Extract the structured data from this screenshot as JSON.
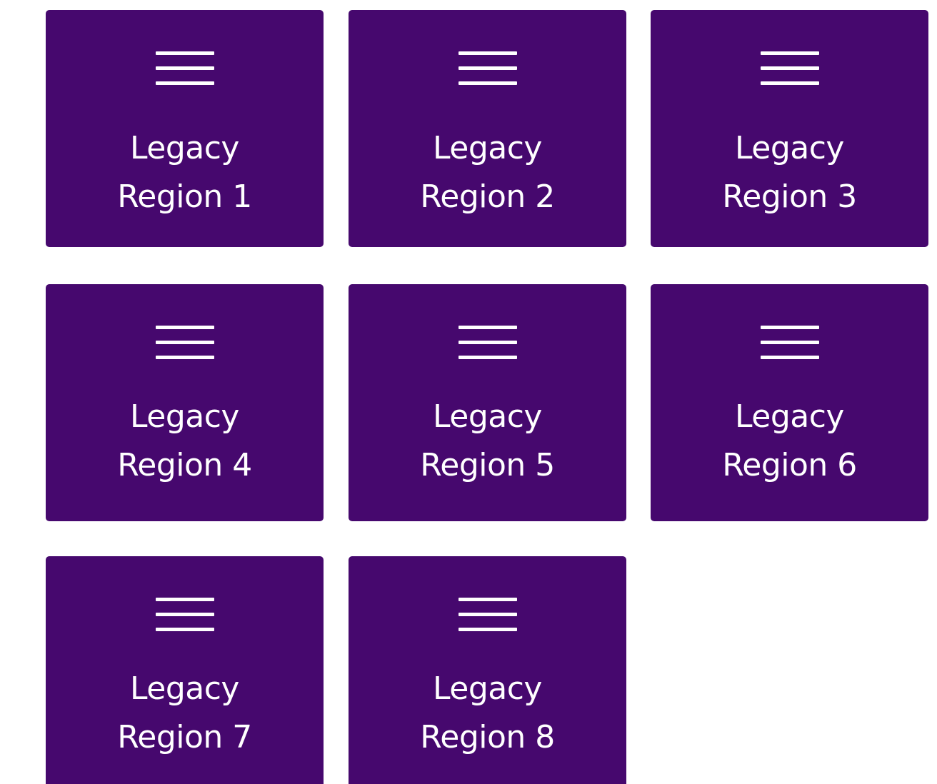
{
  "theme": {
    "tile_color": "#46086e",
    "text_color": "#ffffff"
  },
  "tiles": [
    {
      "line1": "Legacy",
      "line2": "Region 1",
      "icon": "hamburger-menu-icon"
    },
    {
      "line1": "Legacy",
      "line2": "Region 2",
      "icon": "hamburger-menu-icon"
    },
    {
      "line1": "Legacy",
      "line2": "Region 3",
      "icon": "hamburger-menu-icon"
    },
    {
      "line1": "Legacy",
      "line2": "Region 4",
      "icon": "hamburger-menu-icon"
    },
    {
      "line1": "Legacy",
      "line2": "Region 5",
      "icon": "hamburger-menu-icon"
    },
    {
      "line1": "Legacy",
      "line2": "Region 6",
      "icon": "hamburger-menu-icon"
    },
    {
      "line1": "Legacy",
      "line2": "Region 7",
      "icon": "hamburger-menu-icon"
    },
    {
      "line1": "Legacy",
      "line2": "Region 8",
      "icon": "hamburger-menu-icon"
    }
  ]
}
